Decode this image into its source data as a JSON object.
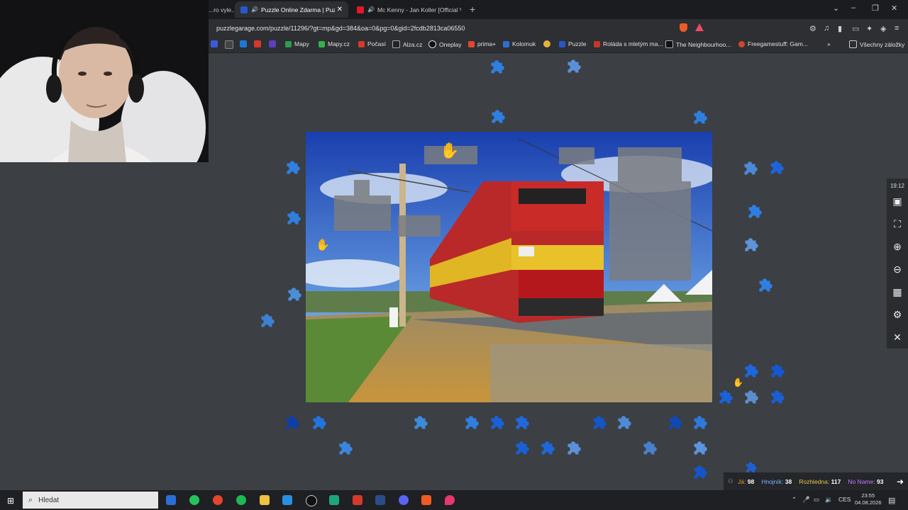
{
  "browser": {
    "tabs": [
      {
        "label": "...ro vyle...",
        "active": false
      },
      {
        "label": "Puzzle Online Zdarma | Puzzl...",
        "active": true
      },
      {
        "label": "Mc Kenny - Jan Koller [Official Vid...",
        "active": false
      }
    ],
    "url": "puzzlegarage.com/puzzle/11296/?gt=mp&gd=384&oa=0&pg=0&gid=2fcdb2813ca06550",
    "bookmarks": [
      "Mapy",
      "Mapy.cz",
      "Počasí",
      "Alza.cz",
      "Oneplay",
      "prima+",
      "Kolomuk",
      "Puzzle",
      "Roláda s mletým ma...",
      "The Neighbourhoo...",
      "Freegamestuff: Gam..."
    ],
    "all_bookmarks": "Všechny záložky"
  },
  "puzzle": {
    "timer": "19:12",
    "toolbar": [
      "image-icon",
      "fullscreen-icon",
      "zoom-in-icon",
      "zoom-out-icon",
      "grid-icon",
      "settings-icon",
      "close-icon"
    ]
  },
  "scores": [
    {
      "name": "Já:",
      "value": "98",
      "color": "#d9a02c"
    },
    {
      "name": "Hnojník:",
      "value": "38",
      "color": "#7fb2ff"
    },
    {
      "name": "Rozhledna:",
      "value": "117",
      "color": "#e8c64a"
    },
    {
      "name": "No Name:",
      "value": "93",
      "color": "#c07bff"
    }
  ],
  "taskbar": {
    "search_placeholder": "Hledat",
    "language": "CES",
    "time": "23:55",
    "date": "04.08.2026"
  }
}
